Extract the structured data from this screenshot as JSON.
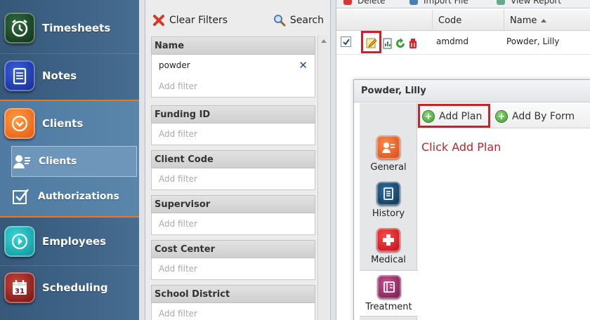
{
  "sidebar": {
    "items": [
      {
        "label": "Timesheets",
        "icon": "alarm-clock-icon"
      },
      {
        "label": "Notes",
        "icon": "notepad-icon"
      },
      {
        "label": "Clients",
        "icon": "chevron-circle-icon",
        "active": true
      },
      {
        "label": "Employees",
        "icon": "play-circle-icon"
      },
      {
        "label": "Scheduling",
        "icon": "calendar-icon"
      }
    ],
    "sub_items": [
      {
        "label": "Clients",
        "icon": "user-card-icon",
        "selected": true
      },
      {
        "label": "Authorizations",
        "icon": "checkbox-icon"
      }
    ],
    "calendar_day": "31",
    "accent_color": "#e8781f"
  },
  "filter_panel": {
    "clear_filters_label": "Clear Filters",
    "search_label": "Search",
    "groups": [
      {
        "title": "Name",
        "value": "powder",
        "add_placeholder": "Add filter"
      },
      {
        "title": "Funding ID",
        "add_placeholder": "Add filter"
      },
      {
        "title": "Client Code",
        "add_placeholder": "Add filter"
      },
      {
        "title": "Supervisor",
        "add_placeholder": "Add filter"
      },
      {
        "title": "Cost Center",
        "add_placeholder": "Add filter"
      },
      {
        "title": "School District",
        "add_placeholder": "Add filter"
      }
    ]
  },
  "grid": {
    "toolbar": [
      "Delete",
      "Import File",
      "View Report"
    ],
    "columns": [
      "Code",
      "Name"
    ],
    "rows": [
      {
        "checked": true,
        "code": "amdmd",
        "name": "Powder, Lilly"
      }
    ]
  },
  "detail": {
    "title": "Powder, Lilly",
    "tabs": [
      {
        "label": "General",
        "icon": "person-card-icon",
        "color": "#e8652a"
      },
      {
        "label": "History",
        "icon": "history-notepad-icon",
        "color": "#1c4f7a"
      },
      {
        "label": "Medical",
        "icon": "medical-cross-icon",
        "color": "#d8222b"
      },
      {
        "label": "Treatment",
        "icon": "treatment-binder-icon",
        "color": "#9b2b6e",
        "selected": true
      }
    ],
    "add_plan_label": "Add Plan",
    "add_by_form_label": "Add By Form",
    "instruction": "Click Add Plan",
    "highlight_color": "#c8232b"
  }
}
